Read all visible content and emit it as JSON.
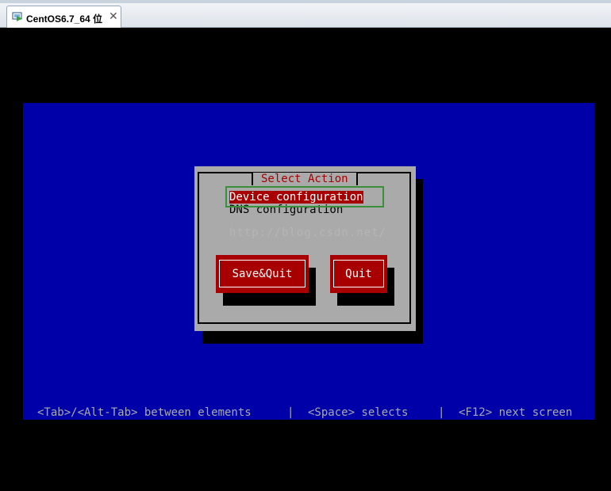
{
  "window": {
    "tab_label": "CentOS6.7_64 位"
  },
  "dialog": {
    "title": "Select Action",
    "items": [
      {
        "label": "Device configuration",
        "selected": true
      },
      {
        "label": "DNS configuration",
        "selected": false
      }
    ],
    "watermark": "http://blog.csdn.net/",
    "buttons": {
      "save_quit": "Save&Quit",
      "quit": "Quit"
    }
  },
  "status_bar": {
    "hint_tab": "<Tab>/<Alt-Tab> between elements",
    "separator": "|",
    "hint_space": "<Space> selects",
    "hint_f12": "<F12> next screen"
  },
  "colors": {
    "console_bg": "#0000a8",
    "dialog_bg": "#aaaaaa",
    "accent_red": "#a80000",
    "focus_green": "#3a8f3a"
  }
}
